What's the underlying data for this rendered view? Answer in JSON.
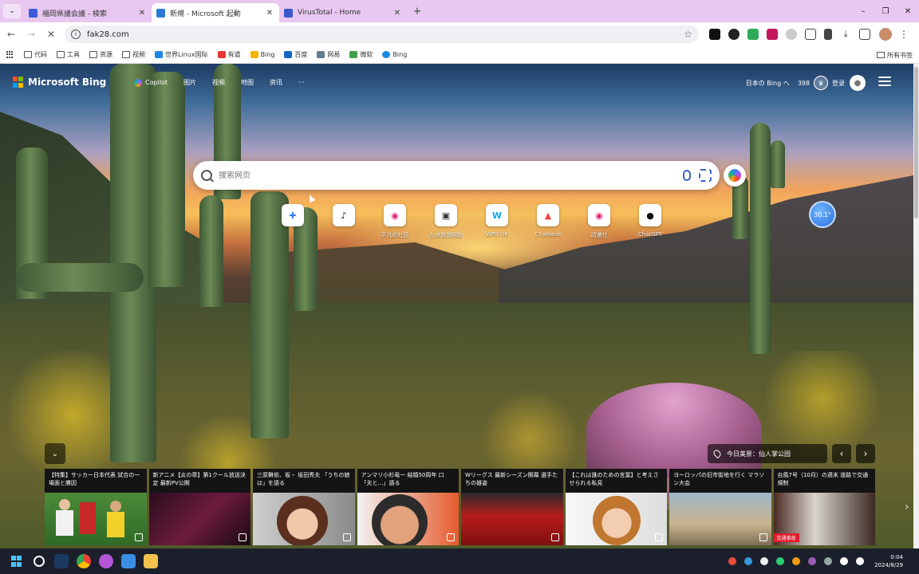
{
  "browser": {
    "tabs": [
      {
        "title": "福岡県議会議 - 検索",
        "favicon_color": "#3b5bdb",
        "active": false
      },
      {
        "title": "新規 - Microsoft 起動",
        "favicon_color": "#2b7bd6",
        "active": true
      },
      {
        "title": "VirusTotal - Home",
        "favicon_color": "#3957c9",
        "active": false
      }
    ],
    "new_tab_symbol": "+",
    "window_controls": {
      "menu": "⌄",
      "minimize": "–",
      "restore": "❐",
      "close": "✕"
    },
    "url": "fak28.com",
    "bookmarks": [
      {
        "label": "代码",
        "icon_color": "folder"
      },
      {
        "label": "工具",
        "icon_color": "folder"
      },
      {
        "label": "资源",
        "icon_color": "folder"
      },
      {
        "label": "视频",
        "icon_color": "folder"
      },
      {
        "label": "世界Linux国际",
        "icon_color": "#1e88e5"
      },
      {
        "label": "有道",
        "icon_color": "#e53935"
      },
      {
        "label": "Bing",
        "icon_color": "#f4b400"
      },
      {
        "label": "百度",
        "icon_color": "#1565c0"
      },
      {
        "label": "网易",
        "icon_color": "#607d8b"
      },
      {
        "label": "微软",
        "icon_color": "#43a047"
      },
      {
        "label": "Bing",
        "icon_color": "#1e88e5"
      }
    ],
    "bookmarks_right": "所有书签"
  },
  "bing": {
    "logo_text": "Microsoft Bing",
    "nav": [
      "Copilot",
      "图片",
      "视频",
      "地图",
      "资讯",
      "···"
    ],
    "region_label": "日本の Bing へ",
    "points": "398",
    "signin_label": "登录",
    "search_placeholder": "搜索网页",
    "quick_links": [
      {
        "icon": "✚",
        "label": "",
        "icon_color": "#3b82f6"
      },
      {
        "icon": "♪",
        "label": "",
        "icon_color": "#111111"
      },
      {
        "icon": "◉",
        "label": "平凡の社区",
        "icon_color": "#e11d74"
      },
      {
        "icon": "▣",
        "label": "九州旅游网站",
        "icon_color": "#333333"
      },
      {
        "icon": "W",
        "label": "WPS OK",
        "icon_color": "#0ea5e9"
      },
      {
        "icon": "▲",
        "label": "Chamelle",
        "icon_color": "#ef4444"
      },
      {
        "icon": "◉",
        "label": "动漫社",
        "icon_color": "#e11d74"
      },
      {
        "icon": "●",
        "label": "ChatGPT",
        "icon_color": "#111111"
      }
    ],
    "weather": "30.1°",
    "info_pill": "今日美景：仙人掌公园",
    "collapse_icon": "⌄",
    "prev_icon": "‹",
    "next_icon": "›",
    "news": [
      {
        "headline": "【特集】サッカー日本代表 試合の一場面と勝因",
        "thumb": "soccer"
      },
      {
        "headline": "新アニメ【炎の章】第1クール放送決定 最新PV公開",
        "thumb": "anime"
      },
      {
        "headline": "三原舞依、坂・ 坂田秀夫 「うちの娘は」を語る",
        "thumb": "woman1"
      },
      {
        "headline": "アンマリ小杉竜一 結婚50周年 口「夫と…」語る",
        "thumb": "man1"
      },
      {
        "headline": "Wリーグス 最新シーズン開幕 選手たちの雄姿",
        "thumb": "team"
      },
      {
        "headline": "【これは誰のための言葉】と考えさせられる私見",
        "thumb": "woman2"
      },
      {
        "headline": "ヨーロッパの旧市街地を行く マラソン大会",
        "thumb": "street"
      },
      {
        "headline": "台風7号（10月）の週末 道路で交通規制",
        "thumb": "city",
        "tag": "交通事故"
      }
    ]
  },
  "taskbar": {
    "clock_time": "0:04",
    "clock_date": "2024/8/29"
  }
}
